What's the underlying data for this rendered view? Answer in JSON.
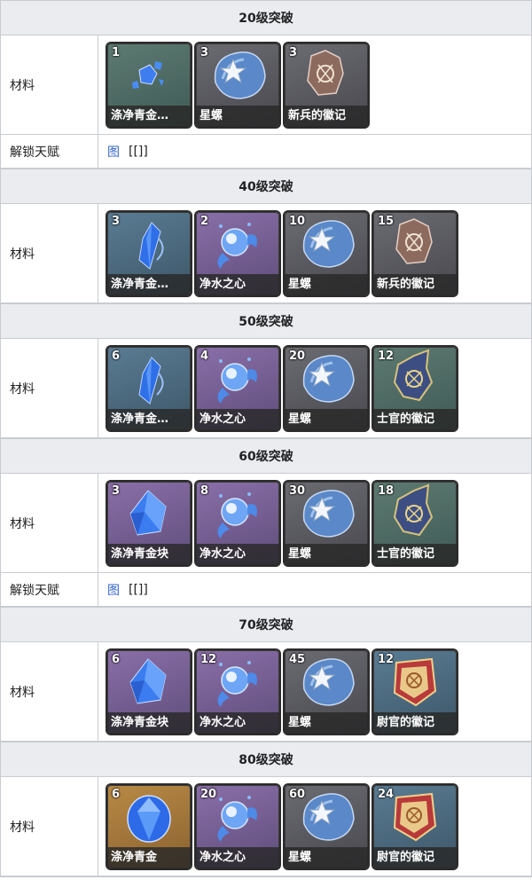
{
  "sections": [
    {
      "header": "20级突破",
      "materials_label": "材料",
      "items": [
        {
          "count": "1",
          "name": "涤净青金…",
          "icon": "gem-shards-icon",
          "rarity": "green"
        },
        {
          "count": "3",
          "name": "星螺",
          "icon": "starconch-icon",
          "rarity": "gray"
        },
        {
          "count": "3",
          "name": "新兵的徽记",
          "icon": "insignia-icon",
          "rarity": "gray"
        }
      ],
      "talent": {
        "label": "解锁天赋",
        "link": "图",
        "text": "[[]]"
      }
    },
    {
      "header": "40级突破",
      "materials_label": "材料",
      "items": [
        {
          "count": "3",
          "name": "涤净青金…",
          "icon": "gem-fragment-icon",
          "rarity": "blue"
        },
        {
          "count": "2",
          "name": "净水之心",
          "icon": "water-heart-icon",
          "rarity": "purple"
        },
        {
          "count": "10",
          "name": "星螺",
          "icon": "starconch-icon",
          "rarity": "gray"
        },
        {
          "count": "15",
          "name": "新兵的徽记",
          "icon": "insignia-icon",
          "rarity": "gray"
        }
      ]
    },
    {
      "header": "50级突破",
      "materials_label": "材料",
      "items": [
        {
          "count": "6",
          "name": "涤净青金…",
          "icon": "gem-fragment-icon",
          "rarity": "blue"
        },
        {
          "count": "4",
          "name": "净水之心",
          "icon": "water-heart-icon",
          "rarity": "purple"
        },
        {
          "count": "20",
          "name": "星螺",
          "icon": "starconch-icon",
          "rarity": "gray"
        },
        {
          "count": "12",
          "name": "士官的徽记",
          "icon": "sergeant-insignia-icon",
          "rarity": "green"
        }
      ]
    },
    {
      "header": "60级突破",
      "materials_label": "材料",
      "items": [
        {
          "count": "3",
          "name": "涤净青金块",
          "icon": "gem-chunk-icon",
          "rarity": "purple"
        },
        {
          "count": "8",
          "name": "净水之心",
          "icon": "water-heart-icon",
          "rarity": "purple"
        },
        {
          "count": "30",
          "name": "星螺",
          "icon": "starconch-icon",
          "rarity": "gray"
        },
        {
          "count": "18",
          "name": "士官的徽记",
          "icon": "sergeant-insignia-icon",
          "rarity": "green"
        }
      ],
      "talent": {
        "label": "解锁天赋",
        "link": "图",
        "text": "[[]]"
      }
    },
    {
      "header": "70级突破",
      "materials_label": "材料",
      "items": [
        {
          "count": "6",
          "name": "涤净青金块",
          "icon": "gem-chunk-icon",
          "rarity": "purple"
        },
        {
          "count": "12",
          "name": "净水之心",
          "icon": "water-heart-icon",
          "rarity": "purple"
        },
        {
          "count": "45",
          "name": "星螺",
          "icon": "starconch-icon",
          "rarity": "gray"
        },
        {
          "count": "12",
          "name": "尉官的徽记",
          "icon": "lieutenant-insignia-icon",
          "rarity": "blue"
        }
      ]
    },
    {
      "header": "80级突破",
      "materials_label": "材料",
      "items": [
        {
          "count": "6",
          "name": "涤净青金",
          "icon": "gem-full-icon",
          "rarity": "gold"
        },
        {
          "count": "20",
          "name": "净水之心",
          "icon": "water-heart-icon",
          "rarity": "purple"
        },
        {
          "count": "60",
          "name": "星螺",
          "icon": "starconch-icon",
          "rarity": "gray"
        },
        {
          "count": "24",
          "name": "尉官的徽记",
          "icon": "lieutenant-insignia-icon",
          "rarity": "blue"
        }
      ]
    }
  ],
  "colors": {
    "header_bg": "#eaecf0",
    "border": "#c8ccd1",
    "link": "#3366cc"
  }
}
